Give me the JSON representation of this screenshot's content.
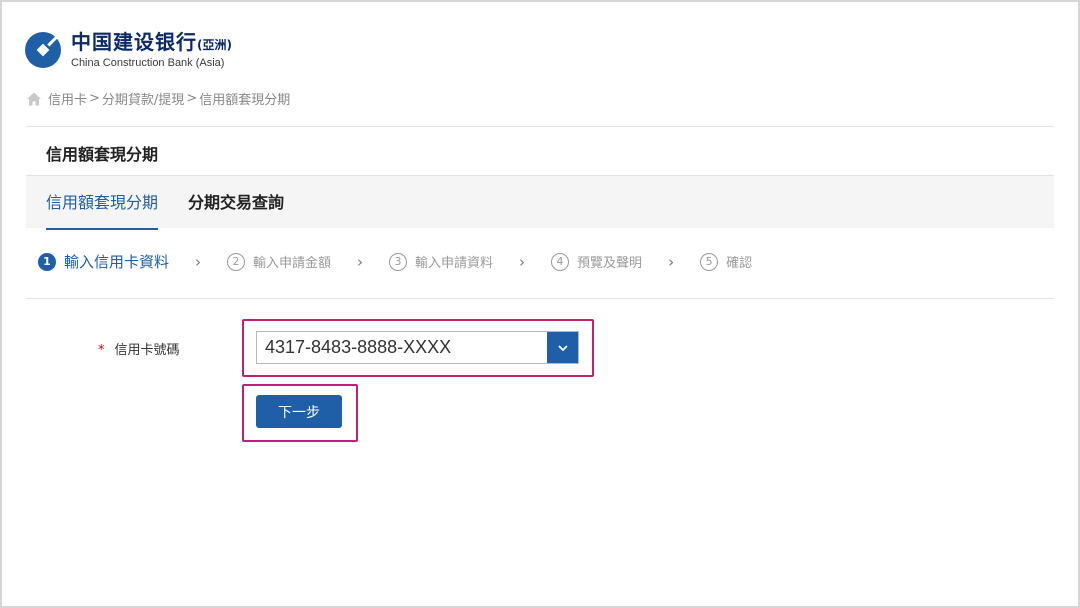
{
  "brand": {
    "name_cn": "中国建设银行",
    "name_cn_suffix": "(亞洲)",
    "name_en": "China Construction Bank (Asia)",
    "logo_icon": "ccb-logo-icon",
    "color": "#1f5fa8"
  },
  "breadcrumb": {
    "home_icon": "home-icon",
    "items": [
      "信用卡",
      "分期貸款/提現",
      "信用額套現分期"
    ],
    "separator": ">"
  },
  "page": {
    "title": "信用額套現分期"
  },
  "tabs": [
    {
      "label": "信用額套現分期",
      "active": true
    },
    {
      "label": "分期交易查詢",
      "active": false
    }
  ],
  "steps": [
    {
      "num": "1",
      "label": "輸入信用卡資料",
      "active": true
    },
    {
      "num": "2",
      "label": "輸入申請金額",
      "active": false
    },
    {
      "num": "3",
      "label": "輸入申請資料",
      "active": false
    },
    {
      "num": "4",
      "label": "預覽及聲明",
      "active": false
    },
    {
      "num": "5",
      "label": "確認",
      "active": false
    }
  ],
  "form": {
    "required_mark": "*",
    "card_label": "信用卡號碼",
    "card_value": "4317-8483-8888-XXXX",
    "dropdown_icon": "chevron-down-icon",
    "next_label": "下一步"
  },
  "colors": {
    "accent": "#1f5fa8",
    "highlight": "#c21f7a",
    "required": "#d0021b"
  }
}
